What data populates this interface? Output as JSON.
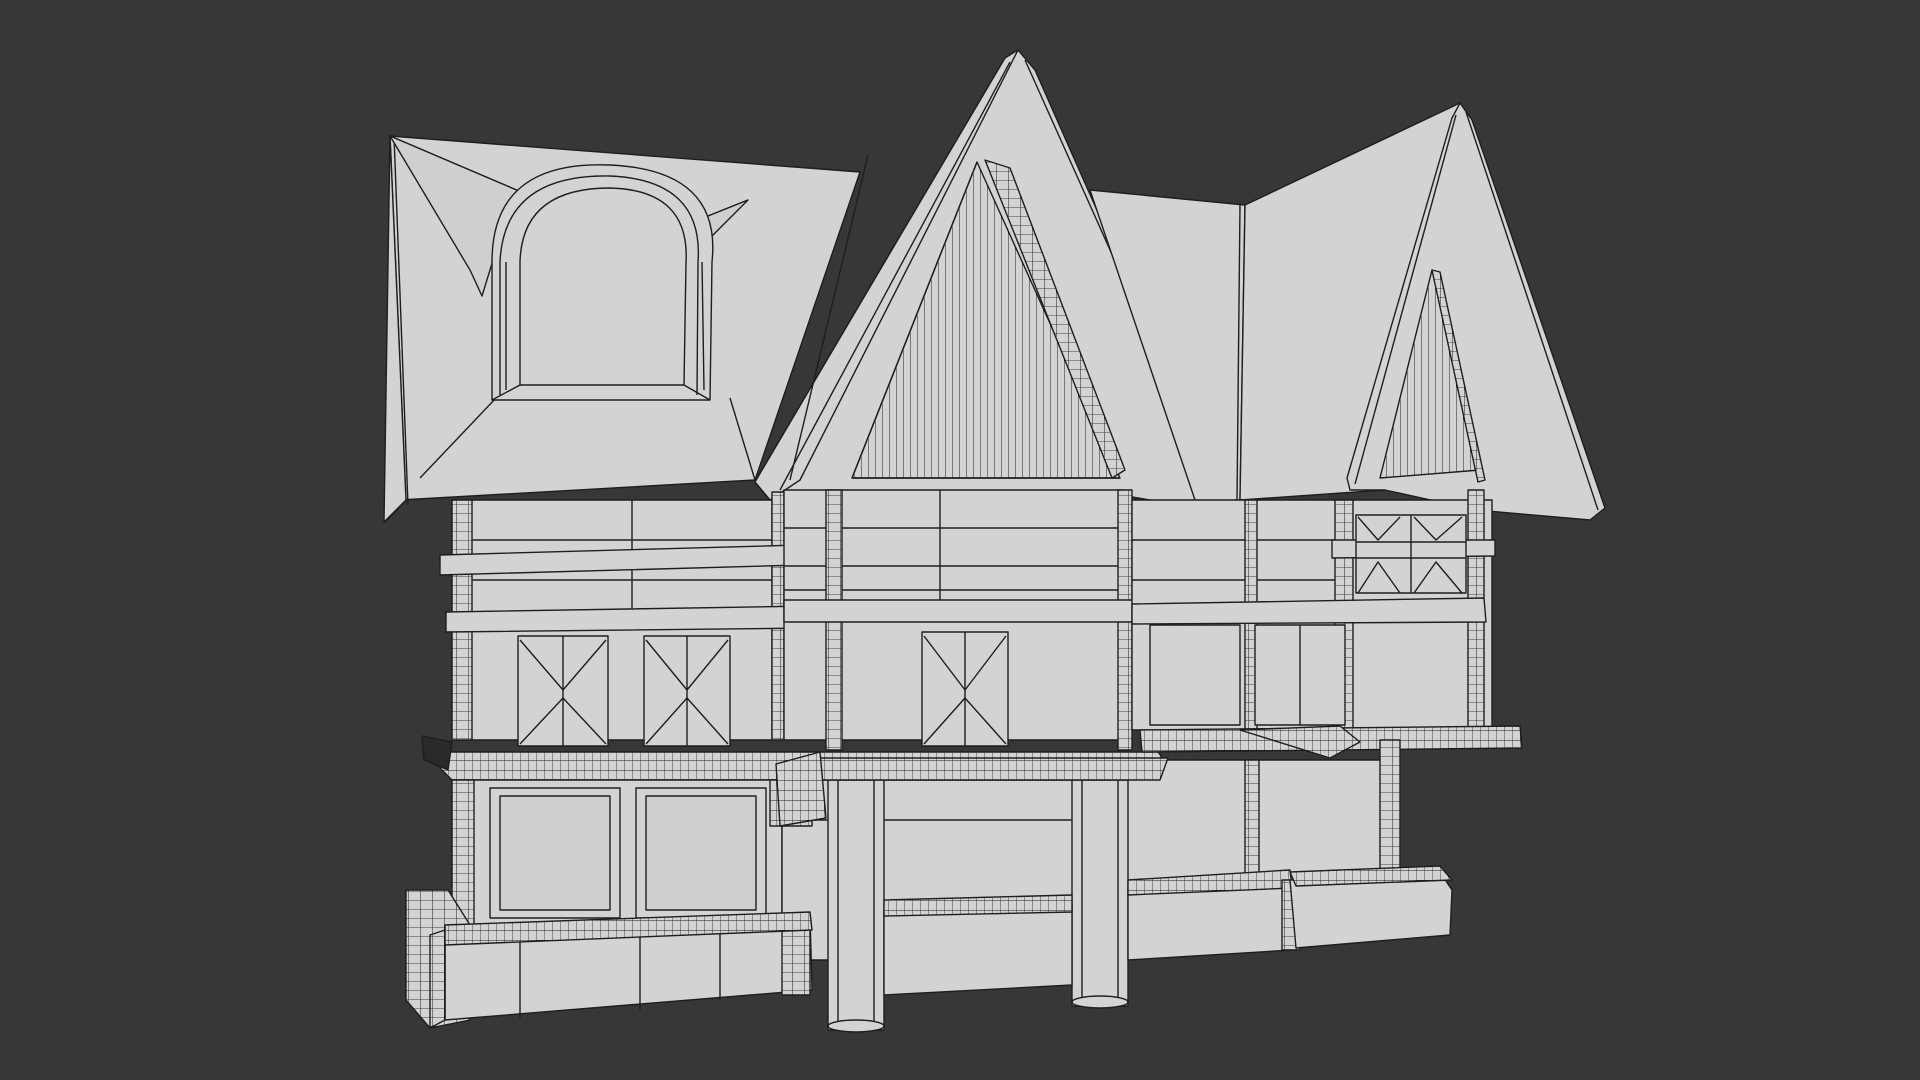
{
  "viewport": {
    "background": "#373737",
    "surface": "#d3d3d3",
    "surface_shade": "#c6c6c6",
    "wire": "#1e1e1e"
  },
  "model": {
    "style": "clay wireframe render of a timber-framed medieval house"
  }
}
